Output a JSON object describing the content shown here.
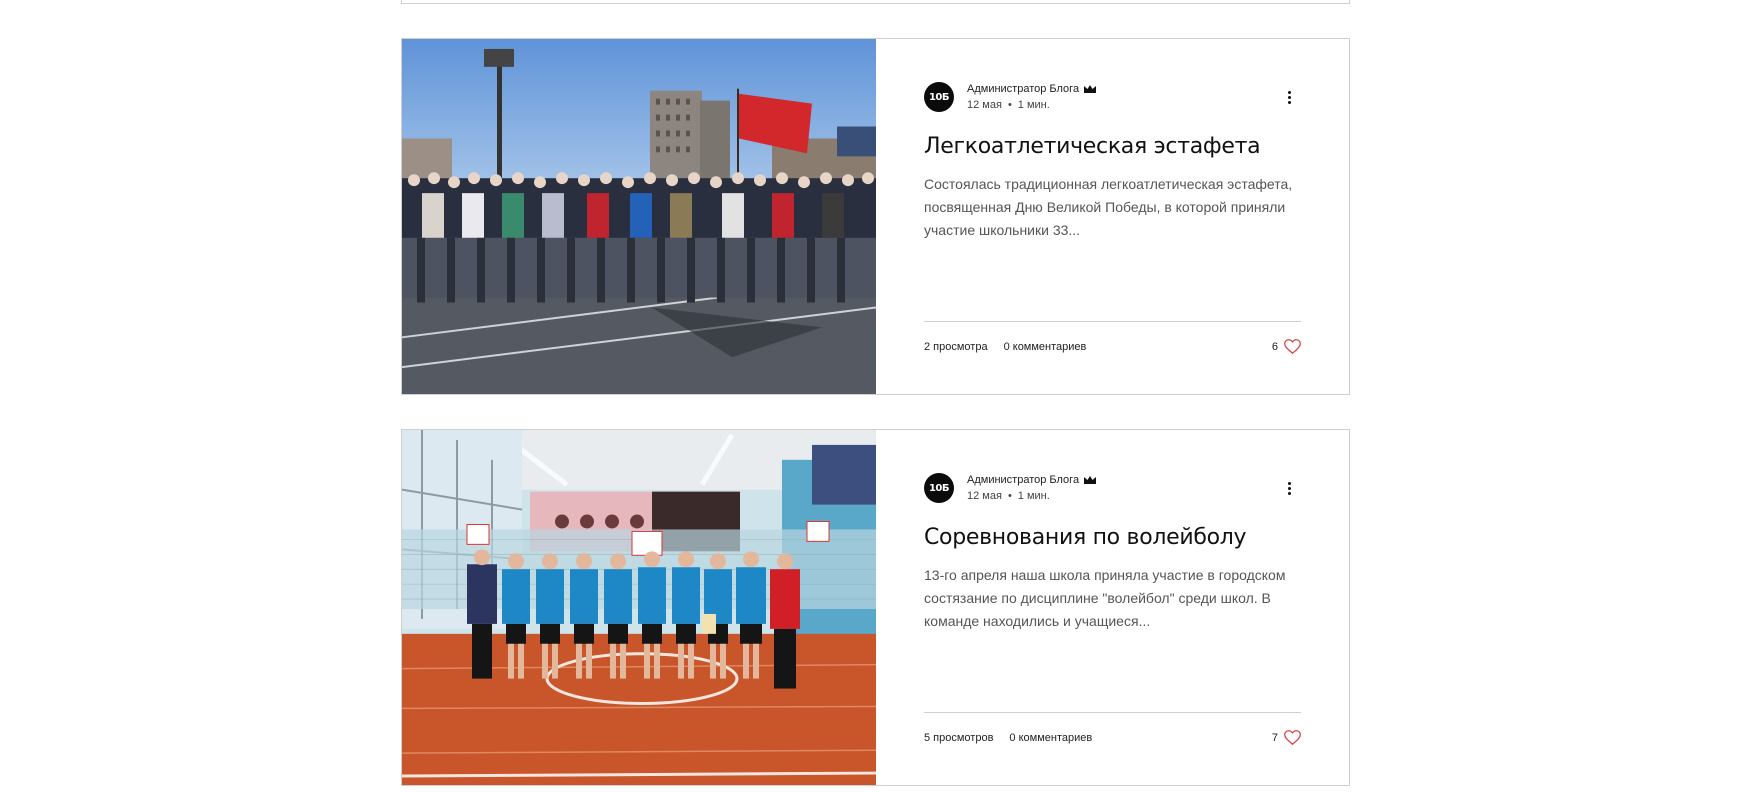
{
  "posts": [
    {
      "author": "Администратор Блога",
      "avatar_text": "10Б",
      "date": "12 мая",
      "read_time": "1 мин.",
      "dot": "•",
      "title": "Легкоатлетическая эстафета",
      "excerpt": "Состоялась традиционная легкоатлетическая эстафета, посвященная Дню Великой Победы, в которой приняли участие школьники 33...",
      "views": "2 просмотра",
      "comments": "0 комментариев",
      "likes": "6",
      "image": "photo of students lined up at a stadium with a red flag"
    },
    {
      "author": "Администратор Блога",
      "avatar_text": "10Б",
      "date": "12 мая",
      "read_time": "1 мин.",
      "dot": "•",
      "title": "Соревнования по волейболу",
      "excerpt": "13-го апреля наша школа приняла участие в городском состязание по дисциплине \"волейбол\" среди школ. В команде находились и учащиеся...",
      "views": "5 просмотров",
      "comments": "0 комментариев",
      "likes": "7",
      "image": "photo of volleyball team in blue jerseys in a school gym"
    }
  ],
  "colors": {
    "heart": "#d64545",
    "border": "#cfcfcf",
    "avatar_bg": "#0b0b0b"
  }
}
